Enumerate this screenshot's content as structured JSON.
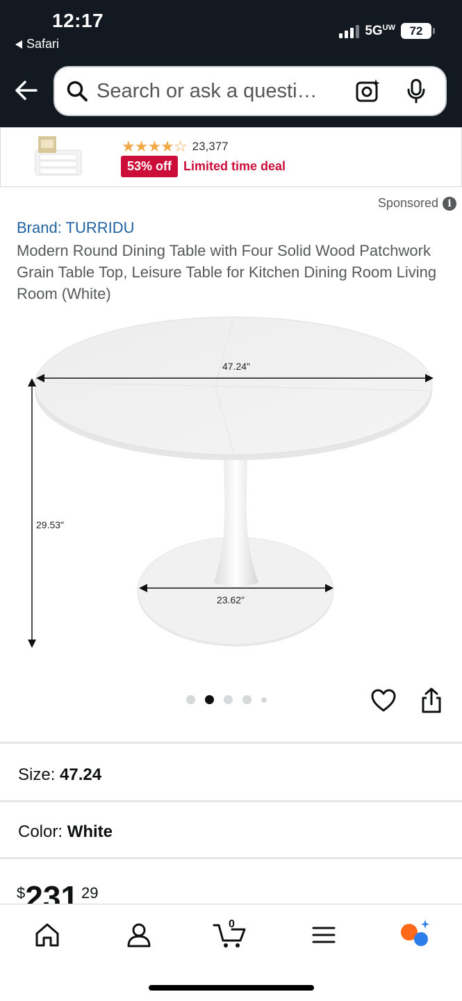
{
  "status_bar": {
    "time": "12:17",
    "back_app": "Safari",
    "network": "5G",
    "network_suffix": "UW",
    "battery": "72"
  },
  "search": {
    "placeholder": "Search or ask a questi…"
  },
  "ad": {
    "rating_stars": "★★★★☆",
    "review_count": "23,377",
    "discount": "53% off",
    "deal_label": "Limited time deal"
  },
  "product": {
    "sponsored_label": "Sponsored",
    "brand": "Brand: TURRIDU",
    "title": "Modern Round Dining Table with Four Solid Wood Patchwork Grain Table Top, Leisure Table for Kitchen Dining Room Living Room (White)",
    "dimensions": {
      "width": "47.24\"",
      "height": "29.53\"",
      "base": "23.62\""
    },
    "image_count": 5,
    "active_image_index": 1
  },
  "options": {
    "size_label": "Size:",
    "size_value": "47.24",
    "color_label": "Color:",
    "color_value": "White"
  },
  "price": {
    "currency": "$",
    "whole": "231",
    "cents": "29"
  },
  "bottom_nav": {
    "cart_count": "0",
    "items": [
      "home-icon",
      "account-icon",
      "cart-icon",
      "menu-icon",
      "rufus-ai-icon"
    ]
  },
  "colors": {
    "header_bg": "#131921",
    "link_blue": "#2162a1",
    "deal_red": "#cc0c39",
    "star_orange": "#f3a847"
  }
}
